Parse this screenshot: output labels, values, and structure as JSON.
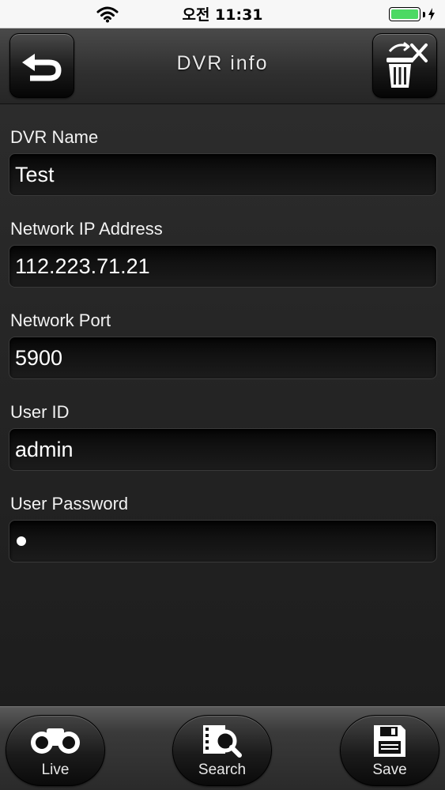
{
  "status_bar": {
    "time": "오전 11:31",
    "battery_level": 1.0,
    "charging": true,
    "wifi_icon": "wifi-icon"
  },
  "header": {
    "title": "DVR info",
    "back_icon": "undo-arrow-icon",
    "delete_icon": "trash-delete-icon"
  },
  "form": {
    "fields": [
      {
        "label": "DVR Name",
        "value": "Test"
      },
      {
        "label": "Network IP Address",
        "value": "112.223.71.21"
      },
      {
        "label": "Network Port",
        "value": "5900"
      },
      {
        "label": "User ID",
        "value": "admin"
      },
      {
        "label": "User Password",
        "value": ""
      }
    ]
  },
  "tabbar": {
    "items": [
      {
        "label": "Live",
        "icon": "binoculars-icon"
      },
      {
        "label": "Search",
        "icon": "film-search-icon"
      },
      {
        "label": "Save",
        "icon": "floppy-disk-icon"
      }
    ]
  },
  "colors": {
    "battery_fill": "#4cd964",
    "background": "#242424",
    "text": "#f2f2f2"
  }
}
